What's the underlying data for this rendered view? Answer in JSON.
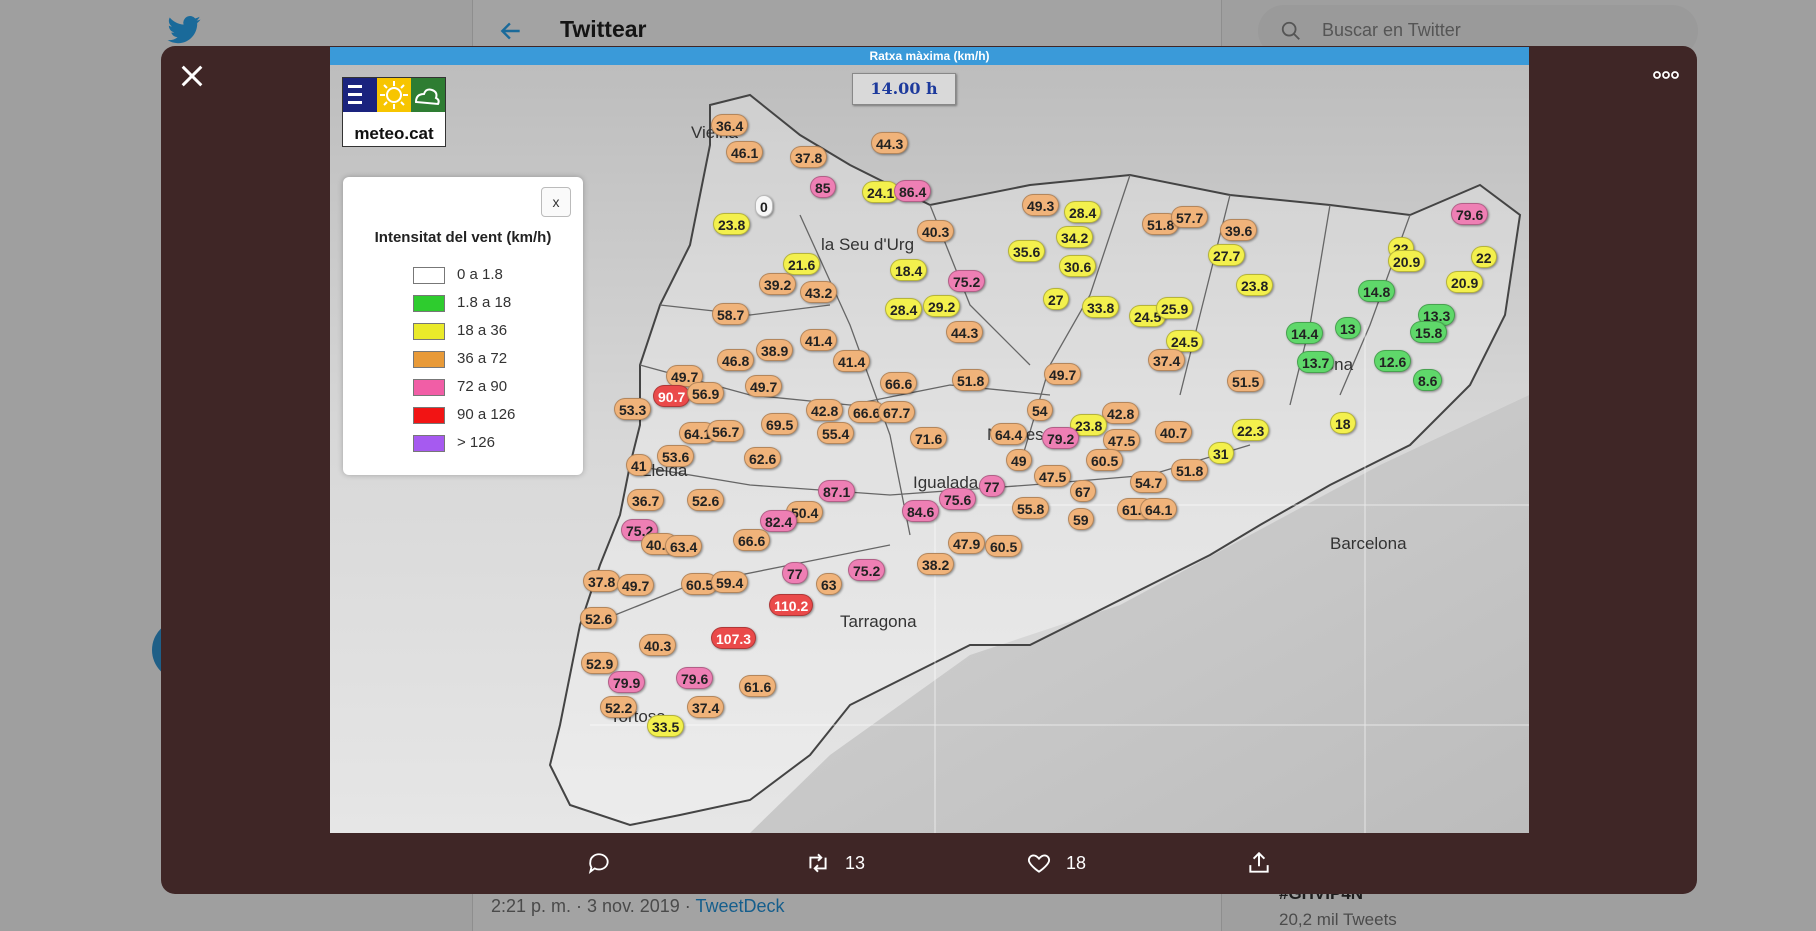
{
  "background": {
    "header_title": "Twittear",
    "search_placeholder": "Buscar en Twitter",
    "tweet_time": "2:21 p. m. · 3 nov. 2019 · ",
    "tweet_source": "TweetDeck",
    "trend_name": "#GHVIP4N",
    "trend_count": "20,2 mil Tweets"
  },
  "map": {
    "header": "Ratxa màxima (km/h)",
    "time": "14.00 h",
    "logo_text": "meteo.cat",
    "legend": {
      "close": "x",
      "title": "Intensitat del vent (km/h)",
      "items": [
        {
          "label": "0 a 1.8",
          "color": "#ffffff"
        },
        {
          "label": "1.8 a 18",
          "color": "#2ecc2e"
        },
        {
          "label": "18 a 36",
          "color": "#eaea2a"
        },
        {
          "label": "36 a 72",
          "color": "#e89a38"
        },
        {
          "label": "72 a 90",
          "color": "#f15ea6"
        },
        {
          "label": "90 a 126",
          "color": "#f21414"
        },
        {
          "label": "> 126",
          "color": "#a65af0"
        }
      ]
    },
    "places": [
      "Vielha",
      "la Seu d'Urg",
      "Manresa",
      "Lleida",
      "Tortosa",
      "Girona",
      "Igualada",
      "Barcelona",
      "Tarragona"
    ]
  },
  "actions": {
    "reply": "",
    "retweet": "13",
    "like": "18",
    "share": ""
  },
  "colors": {
    "white": "#f7f7f7",
    "green": "#5fd86a",
    "yellow": "#f3f04d",
    "orange": "#f0b37a",
    "pink": "#ee7fb4",
    "red": "#ea4a4a"
  }
}
